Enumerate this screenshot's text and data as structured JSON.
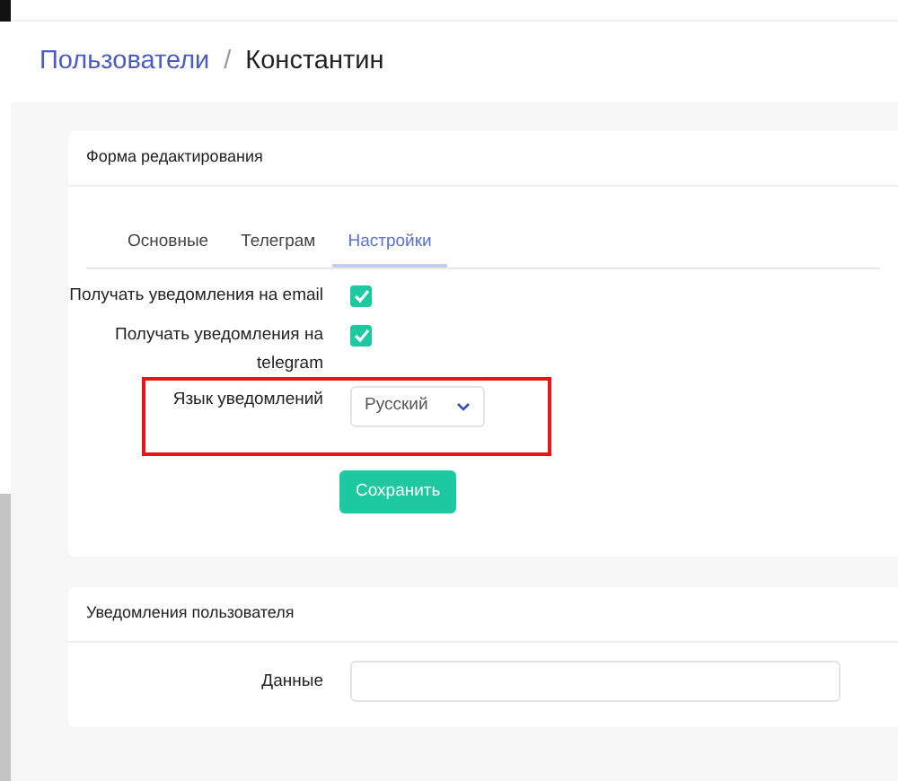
{
  "breadcrumb": [
    {
      "label": "Пользователи",
      "kind": "link"
    },
    {
      "label": "/",
      "kind": "separator"
    },
    {
      "label": "Константин",
      "kind": "current"
    }
  ],
  "edit_card": {
    "title": "Форма редактирования",
    "tabs": [
      {
        "label": "Основные",
        "selected": false
      },
      {
        "label": "Телеграм",
        "selected": false
      },
      {
        "label": "Настройки",
        "selected": true
      }
    ],
    "fields": [
      {
        "kind": "checkbox",
        "label": "Получать уведомления на email",
        "checked": true
      },
      {
        "kind": "checkbox",
        "label": "Получать уведомления на telegram",
        "checked": true
      },
      {
        "kind": "select",
        "label": "Язык уведомлений",
        "value": "Русский",
        "highlighted": true
      }
    ],
    "save_button": "Сохранить"
  },
  "notifications_card": {
    "title": "Уведомления пользователя",
    "fields": [
      {
        "label": "Данные"
      }
    ]
  }
}
